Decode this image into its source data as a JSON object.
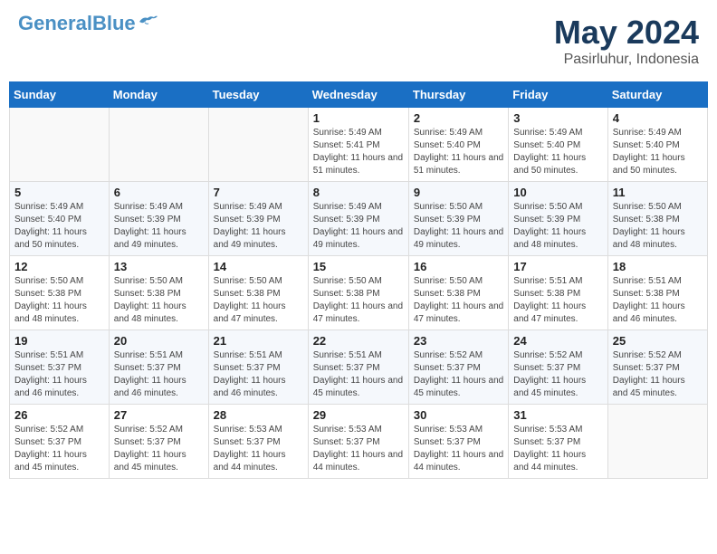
{
  "header": {
    "logo_general": "General",
    "logo_blue": "Blue",
    "month_year": "May 2024",
    "location": "Pasirluhur, Indonesia"
  },
  "weekdays": [
    "Sunday",
    "Monday",
    "Tuesday",
    "Wednesday",
    "Thursday",
    "Friday",
    "Saturday"
  ],
  "weeks": [
    [
      {
        "day": "",
        "sunrise": "",
        "sunset": "",
        "daylight": ""
      },
      {
        "day": "",
        "sunrise": "",
        "sunset": "",
        "daylight": ""
      },
      {
        "day": "",
        "sunrise": "",
        "sunset": "",
        "daylight": ""
      },
      {
        "day": "1",
        "sunrise": "Sunrise: 5:49 AM",
        "sunset": "Sunset: 5:41 PM",
        "daylight": "Daylight: 11 hours and 51 minutes."
      },
      {
        "day": "2",
        "sunrise": "Sunrise: 5:49 AM",
        "sunset": "Sunset: 5:40 PM",
        "daylight": "Daylight: 11 hours and 51 minutes."
      },
      {
        "day": "3",
        "sunrise": "Sunrise: 5:49 AM",
        "sunset": "Sunset: 5:40 PM",
        "daylight": "Daylight: 11 hours and 50 minutes."
      },
      {
        "day": "4",
        "sunrise": "Sunrise: 5:49 AM",
        "sunset": "Sunset: 5:40 PM",
        "daylight": "Daylight: 11 hours and 50 minutes."
      }
    ],
    [
      {
        "day": "5",
        "sunrise": "Sunrise: 5:49 AM",
        "sunset": "Sunset: 5:40 PM",
        "daylight": "Daylight: 11 hours and 50 minutes."
      },
      {
        "day": "6",
        "sunrise": "Sunrise: 5:49 AM",
        "sunset": "Sunset: 5:39 PM",
        "daylight": "Daylight: 11 hours and 49 minutes."
      },
      {
        "day": "7",
        "sunrise": "Sunrise: 5:49 AM",
        "sunset": "Sunset: 5:39 PM",
        "daylight": "Daylight: 11 hours and 49 minutes."
      },
      {
        "day": "8",
        "sunrise": "Sunrise: 5:49 AM",
        "sunset": "Sunset: 5:39 PM",
        "daylight": "Daylight: 11 hours and 49 minutes."
      },
      {
        "day": "9",
        "sunrise": "Sunrise: 5:50 AM",
        "sunset": "Sunset: 5:39 PM",
        "daylight": "Daylight: 11 hours and 49 minutes."
      },
      {
        "day": "10",
        "sunrise": "Sunrise: 5:50 AM",
        "sunset": "Sunset: 5:39 PM",
        "daylight": "Daylight: 11 hours and 48 minutes."
      },
      {
        "day": "11",
        "sunrise": "Sunrise: 5:50 AM",
        "sunset": "Sunset: 5:38 PM",
        "daylight": "Daylight: 11 hours and 48 minutes."
      }
    ],
    [
      {
        "day": "12",
        "sunrise": "Sunrise: 5:50 AM",
        "sunset": "Sunset: 5:38 PM",
        "daylight": "Daylight: 11 hours and 48 minutes."
      },
      {
        "day": "13",
        "sunrise": "Sunrise: 5:50 AM",
        "sunset": "Sunset: 5:38 PM",
        "daylight": "Daylight: 11 hours and 48 minutes."
      },
      {
        "day": "14",
        "sunrise": "Sunrise: 5:50 AM",
        "sunset": "Sunset: 5:38 PM",
        "daylight": "Daylight: 11 hours and 47 minutes."
      },
      {
        "day": "15",
        "sunrise": "Sunrise: 5:50 AM",
        "sunset": "Sunset: 5:38 PM",
        "daylight": "Daylight: 11 hours and 47 minutes."
      },
      {
        "day": "16",
        "sunrise": "Sunrise: 5:50 AM",
        "sunset": "Sunset: 5:38 PM",
        "daylight": "Daylight: 11 hours and 47 minutes."
      },
      {
        "day": "17",
        "sunrise": "Sunrise: 5:51 AM",
        "sunset": "Sunset: 5:38 PM",
        "daylight": "Daylight: 11 hours and 47 minutes."
      },
      {
        "day": "18",
        "sunrise": "Sunrise: 5:51 AM",
        "sunset": "Sunset: 5:38 PM",
        "daylight": "Daylight: 11 hours and 46 minutes."
      }
    ],
    [
      {
        "day": "19",
        "sunrise": "Sunrise: 5:51 AM",
        "sunset": "Sunset: 5:37 PM",
        "daylight": "Daylight: 11 hours and 46 minutes."
      },
      {
        "day": "20",
        "sunrise": "Sunrise: 5:51 AM",
        "sunset": "Sunset: 5:37 PM",
        "daylight": "Daylight: 11 hours and 46 minutes."
      },
      {
        "day": "21",
        "sunrise": "Sunrise: 5:51 AM",
        "sunset": "Sunset: 5:37 PM",
        "daylight": "Daylight: 11 hours and 46 minutes."
      },
      {
        "day": "22",
        "sunrise": "Sunrise: 5:51 AM",
        "sunset": "Sunset: 5:37 PM",
        "daylight": "Daylight: 11 hours and 45 minutes."
      },
      {
        "day": "23",
        "sunrise": "Sunrise: 5:52 AM",
        "sunset": "Sunset: 5:37 PM",
        "daylight": "Daylight: 11 hours and 45 minutes."
      },
      {
        "day": "24",
        "sunrise": "Sunrise: 5:52 AM",
        "sunset": "Sunset: 5:37 PM",
        "daylight": "Daylight: 11 hours and 45 minutes."
      },
      {
        "day": "25",
        "sunrise": "Sunrise: 5:52 AM",
        "sunset": "Sunset: 5:37 PM",
        "daylight": "Daylight: 11 hours and 45 minutes."
      }
    ],
    [
      {
        "day": "26",
        "sunrise": "Sunrise: 5:52 AM",
        "sunset": "Sunset: 5:37 PM",
        "daylight": "Daylight: 11 hours and 45 minutes."
      },
      {
        "day": "27",
        "sunrise": "Sunrise: 5:52 AM",
        "sunset": "Sunset: 5:37 PM",
        "daylight": "Daylight: 11 hours and 45 minutes."
      },
      {
        "day": "28",
        "sunrise": "Sunrise: 5:53 AM",
        "sunset": "Sunset: 5:37 PM",
        "daylight": "Daylight: 11 hours and 44 minutes."
      },
      {
        "day": "29",
        "sunrise": "Sunrise: 5:53 AM",
        "sunset": "Sunset: 5:37 PM",
        "daylight": "Daylight: 11 hours and 44 minutes."
      },
      {
        "day": "30",
        "sunrise": "Sunrise: 5:53 AM",
        "sunset": "Sunset: 5:37 PM",
        "daylight": "Daylight: 11 hours and 44 minutes."
      },
      {
        "day": "31",
        "sunrise": "Sunrise: 5:53 AM",
        "sunset": "Sunset: 5:37 PM",
        "daylight": "Daylight: 11 hours and 44 minutes."
      },
      {
        "day": "",
        "sunrise": "",
        "sunset": "",
        "daylight": ""
      }
    ]
  ]
}
